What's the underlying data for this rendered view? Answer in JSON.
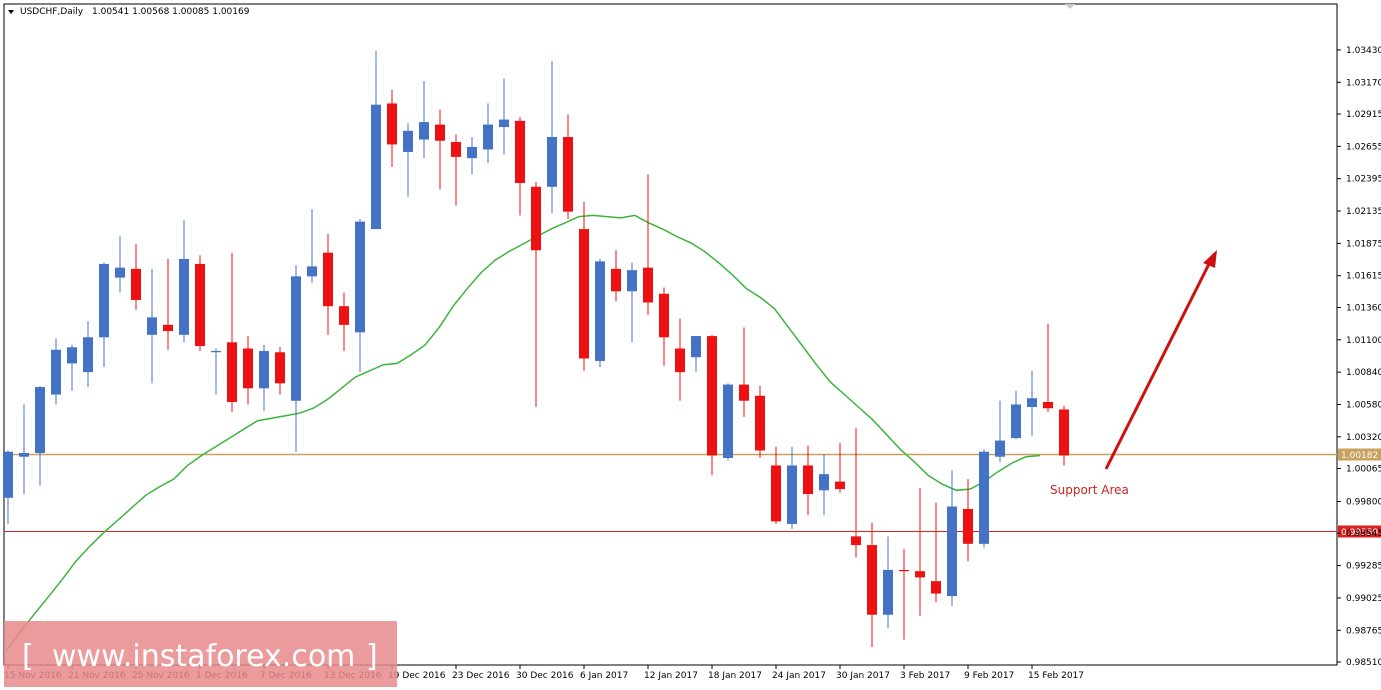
{
  "header": {
    "symbol": "USDCHF,Daily",
    "ohlc": "1.00541 1.00568 1.00085 1.00169"
  },
  "watermark": "www.instaforex.com",
  "annotation": {
    "text": "Support Area"
  },
  "colors": {
    "bull": "#4472c4",
    "bear": "#ee1111",
    "ma": "#3cb43c",
    "support": "#c8a060",
    "resistance": "#e02020",
    "arrow": "#cc1111",
    "watermark_bg": "#e88a8a"
  },
  "chart_data": {
    "type": "candlestick",
    "title": "USDCHF,Daily",
    "ylim": [
      0.9851,
      1.0355
    ],
    "y_ticks": [
      "1.03430",
      "1.03170",
      "1.02915",
      "1.02655",
      "1.02395",
      "1.02135",
      "1.01875",
      "1.01615",
      "1.01360",
      "1.01100",
      "1.00840",
      "1.00580",
      "1.00320",
      "1.00065",
      "0.99800",
      "0.99545",
      "0.99285",
      "0.99025",
      "0.98765",
      "0.98510"
    ],
    "x_ticks": [
      {
        "label": "15 Nov 2016",
        "index": 0
      },
      {
        "label": "21 Nov 2016",
        "index": 4
      },
      {
        "label": "25 Nov 2016",
        "index": 8
      },
      {
        "label": "1 Dec 2016",
        "index": 12
      },
      {
        "label": "7 Dec 2016",
        "index": 16
      },
      {
        "label": "13 Dec 2016",
        "index": 20
      },
      {
        "label": "19 Dec 2016",
        "index": 24
      },
      {
        "label": "23 Dec 2016",
        "index": 28
      },
      {
        "label": "30 Dec 2016",
        "index": 32
      },
      {
        "label": "6 Jan 2017",
        "index": 36
      },
      {
        "label": "12 Jan 2017",
        "index": 40
      },
      {
        "label": "18 Jan 2017",
        "index": 44
      },
      {
        "label": "24 Jan 2017",
        "index": 48
      },
      {
        "label": "30 Jan 2017",
        "index": 52
      },
      {
        "label": "3 Feb 2017",
        "index": 56
      },
      {
        "label": "9 Feb 2017",
        "index": 60
      },
      {
        "label": "15 Feb 2017",
        "index": 64
      }
    ],
    "candles": [
      {
        "o": 0.9983,
        "h": 1.0021,
        "l": 0.9962,
        "c": 1.002
      },
      {
        "o": 1.0016,
        "h": 1.0058,
        "l": 0.9986,
        "c": 1.0019
      },
      {
        "o": 1.0019,
        "h": 1.0073,
        "l": 0.9993,
        "c": 1.0072
      },
      {
        "o": 1.0066,
        "h": 1.0111,
        "l": 1.0058,
        "c": 1.0102
      },
      {
        "o": 1.0091,
        "h": 1.0106,
        "l": 1.0069,
        "c": 1.0104
      },
      {
        "o": 1.0084,
        "h": 1.0125,
        "l": 1.0072,
        "c": 1.0112
      },
      {
        "o": 1.0112,
        "h": 1.0172,
        "l": 1.0088,
        "c": 1.0171
      },
      {
        "o": 1.016,
        "h": 1.0193,
        "l": 1.0148,
        "c": 1.0168
      },
      {
        "o": 1.0167,
        "h": 1.0187,
        "l": 1.0134,
        "c": 1.0142
      },
      {
        "o": 1.0114,
        "h": 1.0167,
        "l": 1.0075,
        "c": 1.0128
      },
      {
        "o": 1.0122,
        "h": 1.0175,
        "l": 1.0102,
        "c": 1.0117
      },
      {
        "o": 1.0114,
        "h": 1.0206,
        "l": 1.0108,
        "c": 1.0175
      },
      {
        "o": 1.0171,
        "h": 1.0178,
        "l": 1.0101,
        "c": 1.0105
      },
      {
        "o": 1.01,
        "h": 1.0103,
        "l": 1.0066,
        "c": 1.0101
      },
      {
        "o": 1.0108,
        "h": 1.018,
        "l": 1.0052,
        "c": 1.006
      },
      {
        "o": 1.0103,
        "h": 1.0113,
        "l": 1.0058,
        "c": 1.0071
      },
      {
        "o": 1.0071,
        "h": 1.0106,
        "l": 1.0053,
        "c": 1.0101
      },
      {
        "o": 1.01,
        "h": 1.0104,
        "l": 1.0066,
        "c": 1.0075
      },
      {
        "o": 1.0061,
        "h": 1.017,
        "l": 1.002,
        "c": 1.0161
      },
      {
        "o": 1.0161,
        "h": 1.0215,
        "l": 1.0156,
        "c": 1.0169
      },
      {
        "o": 1.018,
        "h": 1.0195,
        "l": 1.0114,
        "c": 1.0137
      },
      {
        "o": 1.0137,
        "h": 1.0148,
        "l": 1.0101,
        "c": 1.0122
      },
      {
        "o": 1.0116,
        "h": 1.0207,
        "l": 1.0084,
        "c": 1.0205
      },
      {
        "o": 1.0199,
        "h": 1.0342,
        "l": 1.0199,
        "c": 1.0299
      },
      {
        "o": 1.03,
        "h": 1.0311,
        "l": 1.0249,
        "c": 1.0267
      },
      {
        "o": 1.0261,
        "h": 1.0284,
        "l": 1.0225,
        "c": 1.0278
      },
      {
        "o": 1.0271,
        "h": 1.0318,
        "l": 1.0256,
        "c": 1.0285
      },
      {
        "o": 1.0283,
        "h": 1.0295,
        "l": 1.0231,
        "c": 1.027
      },
      {
        "o": 1.0269,
        "h": 1.0275,
        "l": 1.0218,
        "c": 1.0257
      },
      {
        "o": 1.0256,
        "h": 1.0273,
        "l": 1.0243,
        "c": 1.0265
      },
      {
        "o": 1.0263,
        "h": 1.03,
        "l": 1.0252,
        "c": 1.0283
      },
      {
        "o": 1.0281,
        "h": 1.032,
        "l": 1.0259,
        "c": 1.0287
      },
      {
        "o": 1.0286,
        "h": 1.0289,
        "l": 1.021,
        "c": 1.0236
      },
      {
        "o": 1.0233,
        "h": 1.0237,
        "l": 1.0056,
        "c": 1.0182
      },
      {
        "o": 1.0233,
        "h": 1.0334,
        "l": 1.0212,
        "c": 1.0273
      },
      {
        "o": 1.0273,
        "h": 1.0291,
        "l": 1.0207,
        "c": 1.0213
      },
      {
        "o": 1.0199,
        "h": 1.0221,
        "l": 1.0085,
        "c": 1.0095
      },
      {
        "o": 1.0093,
        "h": 1.0175,
        "l": 1.0088,
        "c": 1.0173
      },
      {
        "o": 1.0167,
        "h": 1.0182,
        "l": 1.0141,
        "c": 1.0149
      },
      {
        "o": 1.0149,
        "h": 1.0172,
        "l": 1.0108,
        "c": 1.0166
      },
      {
        "o": 1.0168,
        "h": 1.0243,
        "l": 1.013,
        "c": 1.014
      },
      {
        "o": 1.0147,
        "h": 1.0152,
        "l": 1.0089,
        "c": 1.0112
      },
      {
        "o": 1.0103,
        "h": 1.0127,
        "l": 1.0061,
        "c": 1.0084
      },
      {
        "o": 1.0096,
        "h": 1.0112,
        "l": 1.0084,
        "c": 1.0113
      },
      {
        "o": 1.0113,
        "h": 1.0114,
        "l": 1.0001,
        "c": 1.0017
      },
      {
        "o": 1.0015,
        "h": 1.0075,
        "l": 1.0013,
        "c": 1.0074
      },
      {
        "o": 1.0074,
        "h": 1.012,
        "l": 1.0048,
        "c": 1.0061
      },
      {
        "o": 1.0065,
        "h": 1.0073,
        "l": 1.0015,
        "c": 1.0021
      },
      {
        "o": 1.0009,
        "h": 1.0024,
        "l": 0.9962,
        "c": 0.9964
      },
      {
        "o": 0.9962,
        "h": 1.0024,
        "l": 0.9958,
        "c": 1.0009
      },
      {
        "o": 1.0009,
        "h": 1.0025,
        "l": 0.9969,
        "c": 0.9986
      },
      {
        "o": 0.9989,
        "h": 1.0018,
        "l": 0.9969,
        "c": 1.0002
      },
      {
        "o": 0.9996,
        "h": 1.0027,
        "l": 0.9987,
        "c": 0.999
      },
      {
        "o": 0.9952,
        "h": 1.0039,
        "l": 0.9935,
        "c": 0.9945
      },
      {
        "o": 0.9945,
        "h": 0.9963,
        "l": 0.9863,
        "c": 0.9889
      },
      {
        "o": 0.9889,
        "h": 0.9952,
        "l": 0.9878,
        "c": 0.9925
      },
      {
        "o": 0.9925,
        "h": 0.9942,
        "l": 0.9869,
        "c": 0.9924
      },
      {
        "o": 0.9924,
        "h": 0.9991,
        "l": 0.9888,
        "c": 0.9919
      },
      {
        "o": 0.9916,
        "h": 0.9979,
        "l": 0.9899,
        "c": 0.9906
      },
      {
        "o": 0.9904,
        "h": 1.0005,
        "l": 0.9896,
        "c": 0.9976
      },
      {
        "o": 0.9974,
        "h": 0.9998,
        "l": 0.9932,
        "c": 0.9946
      },
      {
        "o": 0.9946,
        "h": 1.0022,
        "l": 0.9943,
        "c": 1.002
      },
      {
        "o": 1.0016,
        "h": 1.0061,
        "l": 1.0012,
        "c": 1.0029
      },
      {
        "o": 1.0031,
        "h": 1.0069,
        "l": 1.003,
        "c": 1.0058
      },
      {
        "o": 1.0056,
        "h": 1.0085,
        "l": 1.0033,
        "c": 1.0063
      },
      {
        "o": 1.006,
        "h": 1.0123,
        "l": 1.0052,
        "c": 1.0055
      },
      {
        "o": 1.0054,
        "h": 1.0057,
        "l": 1.0009,
        "c": 1.0017
      }
    ],
    "moving_average": [
      0.986,
      0.9875,
      0.9889,
      0.9903,
      0.9917,
      0.9932,
      0.9944,
      0.9955,
      0.9965,
      0.9975,
      0.9985,
      0.9992,
      0.9998,
      1.0009,
      1.0017,
      1.0024,
      1.0031,
      1.0038,
      1.0045,
      1.0047,
      1.0049,
      1.0051,
      1.0055,
      1.0062,
      1.0071,
      1.008,
      1.0085,
      1.009,
      1.0091,
      1.0098,
      1.0106,
      1.012,
      1.0137,
      1.0151,
      1.0164,
      1.0174,
      1.0181,
      1.0187,
      1.0193,
      1.0199,
      1.0204,
      1.0209,
      1.021,
      1.0209,
      1.0208,
      1.021,
      1.0204,
      1.0199,
      1.0193,
      1.0188,
      1.0181,
      1.0172,
      1.0162,
      1.0151,
      1.0144,
      1.0135,
      1.012,
      1.0105,
      1.009,
      1.0076,
      1.0066,
      1.0056,
      1.0046,
      1.0034,
      1.0022,
      1.0012,
      1.0001,
      0.9994,
      0.9989,
      0.999,
      0.9996,
      1.0004,
      1.0011,
      1.0016,
      1.0017
    ],
    "horizontal_lines": [
      {
        "name": "support",
        "value": 1.00182,
        "label": "1.00182"
      },
      {
        "name": "resistance",
        "value": 0.99559,
        "label": "0.99559"
      }
    ]
  }
}
